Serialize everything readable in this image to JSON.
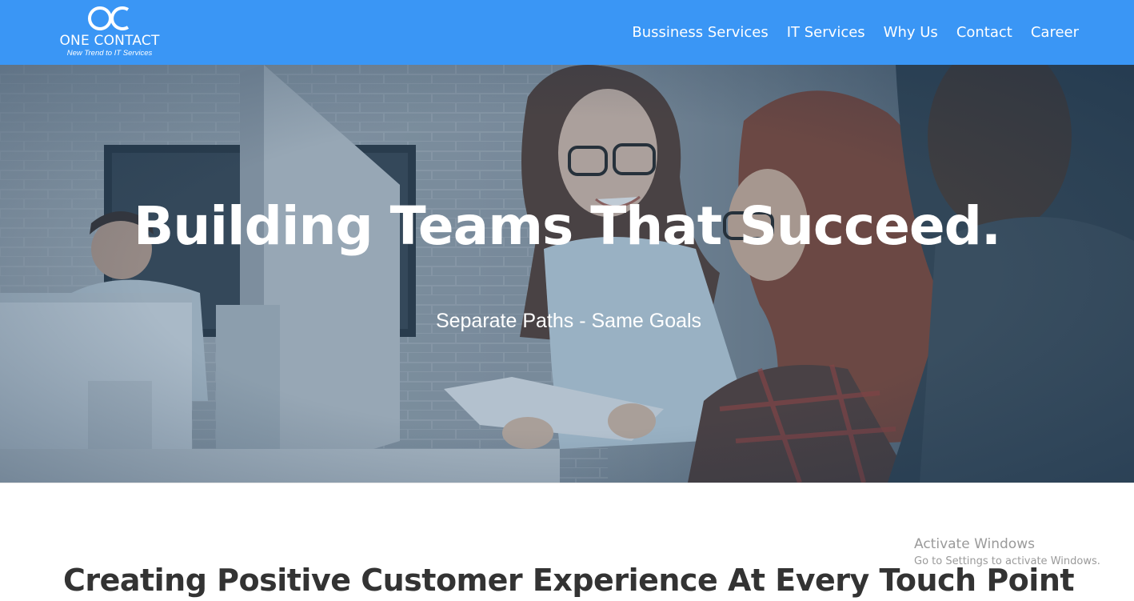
{
  "brand": {
    "monogram": "OC",
    "name": "ONE CONTACT",
    "tagline": "New Trend to IT Services"
  },
  "nav": {
    "items": [
      "Bussiness Services",
      "IT Services",
      "Why Us",
      "Contact",
      "Career"
    ]
  },
  "hero": {
    "title": "Building Teams That Succeed.",
    "subtitle": "Separate Paths - Same Goals"
  },
  "section": {
    "title": "Creating Positive Customer Experience At Every Touch Point"
  },
  "watermark": {
    "title": "Activate Windows",
    "subtitle": "Go to Settings to activate Windows."
  },
  "colors": {
    "header_bg": "#3a96f5",
    "text_white": "#ffffff",
    "heading_dark": "#333333"
  }
}
